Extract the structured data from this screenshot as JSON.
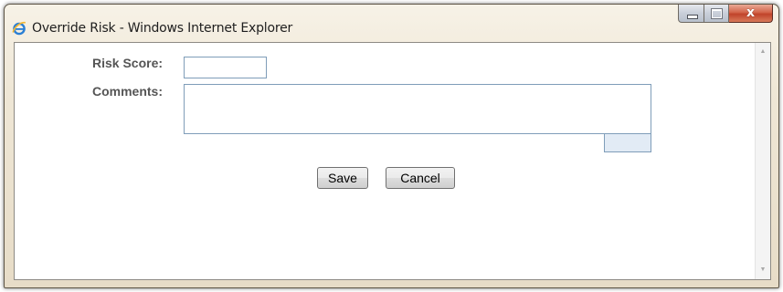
{
  "window": {
    "title": "Override Risk - Windows Internet Explorer",
    "app_icon": "internet-explorer-icon",
    "caption_buttons": {
      "minimize": "minimize-icon",
      "maximize": "maximize-icon",
      "close_glyph": "x"
    }
  },
  "form": {
    "risk_score_label": "Risk Score:",
    "risk_score_value": "",
    "comments_label": "Comments:",
    "comments_value": ""
  },
  "actions": {
    "save_label": "Save",
    "cancel_label": "Cancel"
  },
  "colors": {
    "label_text": "#555555",
    "field_border": "#7f9db9",
    "close_button": "#c74a31"
  }
}
